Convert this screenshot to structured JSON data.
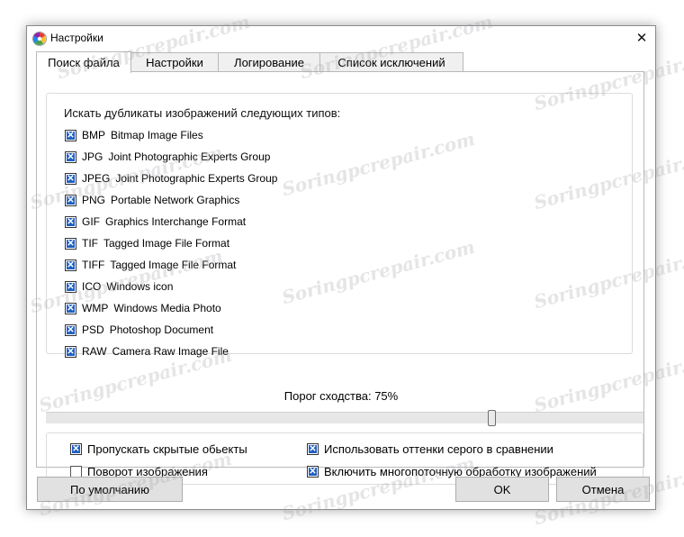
{
  "window": {
    "title": "Настройки",
    "close_glyph": "✕"
  },
  "tabs": [
    {
      "label": "Поиск файла",
      "active": true
    },
    {
      "label": "Настройки",
      "active": false
    },
    {
      "label": "Логирование",
      "active": false
    },
    {
      "label": "Список исключений",
      "active": false
    }
  ],
  "filetypes": {
    "group_title": "Искать дубликаты изображений следующих типов:",
    "items": [
      {
        "ext": "BMP",
        "desc": "Bitmap Image Files",
        "checked": true
      },
      {
        "ext": "JPG",
        "desc": "Joint Photographic Experts Group",
        "checked": true
      },
      {
        "ext": "JPEG",
        "desc": "Joint Photographic Experts Group",
        "checked": true
      },
      {
        "ext": "PNG",
        "desc": "Portable Network Graphics",
        "checked": true
      },
      {
        "ext": "GIF",
        "desc": "Graphics Interchange Format",
        "checked": true
      },
      {
        "ext": "TIF",
        "desc": "Tagged Image File Format",
        "checked": true
      },
      {
        "ext": "TIFF",
        "desc": "Tagged Image File Format",
        "checked": true
      },
      {
        "ext": "ICO",
        "desc": "Windows icon",
        "checked": true
      },
      {
        "ext": "WMP",
        "desc": "Windows Media Photo",
        "checked": true
      },
      {
        "ext": "PSD",
        "desc": "Photoshop Document",
        "checked": true
      },
      {
        "ext": "RAW",
        "desc": "Camera Raw Image File",
        "checked": true
      }
    ]
  },
  "similarity": {
    "label": "Порог сходства: 75%",
    "value": 0.75
  },
  "options": {
    "skip_hidden": {
      "label": "Пропускать скрытые обьекты",
      "checked": true
    },
    "rotate_images": {
      "label": "Поворот изображения",
      "checked": false
    },
    "grayscale": {
      "label": "Использовать оттенки серого в сравнении",
      "checked": true
    },
    "multithread": {
      "label": "Включить многопоточную обработку изображений",
      "checked": true
    }
  },
  "buttons": {
    "defaults": "По умолчанию",
    "ok": "OK",
    "cancel": "Отмена"
  },
  "watermark": "Soringpcrepair.com",
  "colors": {
    "checkbox_fill": "#2060c0",
    "button_bg": "#e1e1e1"
  }
}
